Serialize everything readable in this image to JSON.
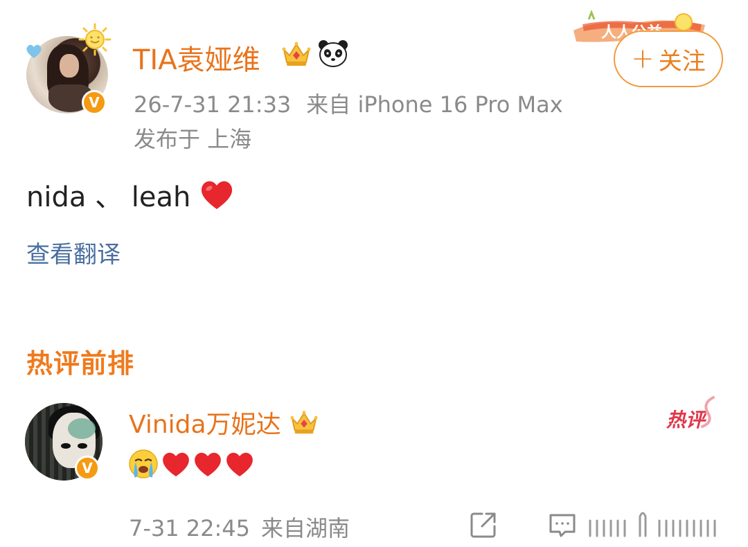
{
  "post": {
    "author": "TIA袁娅维",
    "timestamp": "26-7-31 21:33",
    "source": "来自 iPhone 16 Pro Max",
    "location": "发布于 上海",
    "text": "nida 、 leah",
    "translate_label": "查看翻译",
    "follow_label": "关注",
    "follow_plus": "+",
    "verified_badge": "V",
    "banner_text": "人人公益"
  },
  "comments_section": {
    "title": "热评前排",
    "hot_tag": "热评",
    "comments": [
      {
        "author": "Vinida万妮达",
        "verified_badge": "V",
        "emojis": [
          "crying-face",
          "red-heart",
          "red-heart",
          "red-heart"
        ],
        "timestamp": "7-31 22:45",
        "source": "来自湖南"
      }
    ]
  },
  "icons": {
    "author_decor": [
      "sun-icon",
      "blue-heart-icon",
      "crown-icon",
      "panda-icon"
    ],
    "comment_actions": [
      "share-icon",
      "comment-icon",
      "like-icon"
    ]
  },
  "colors": {
    "username": "#e8731b",
    "follow_border": "#f29a3d",
    "section_title": "#ef7a1e",
    "link": "#4a6f9e",
    "meta": "#8a8a8a",
    "hot_tag": "#e0374b",
    "verified": "#f59a12",
    "heart": "#e8262d"
  }
}
